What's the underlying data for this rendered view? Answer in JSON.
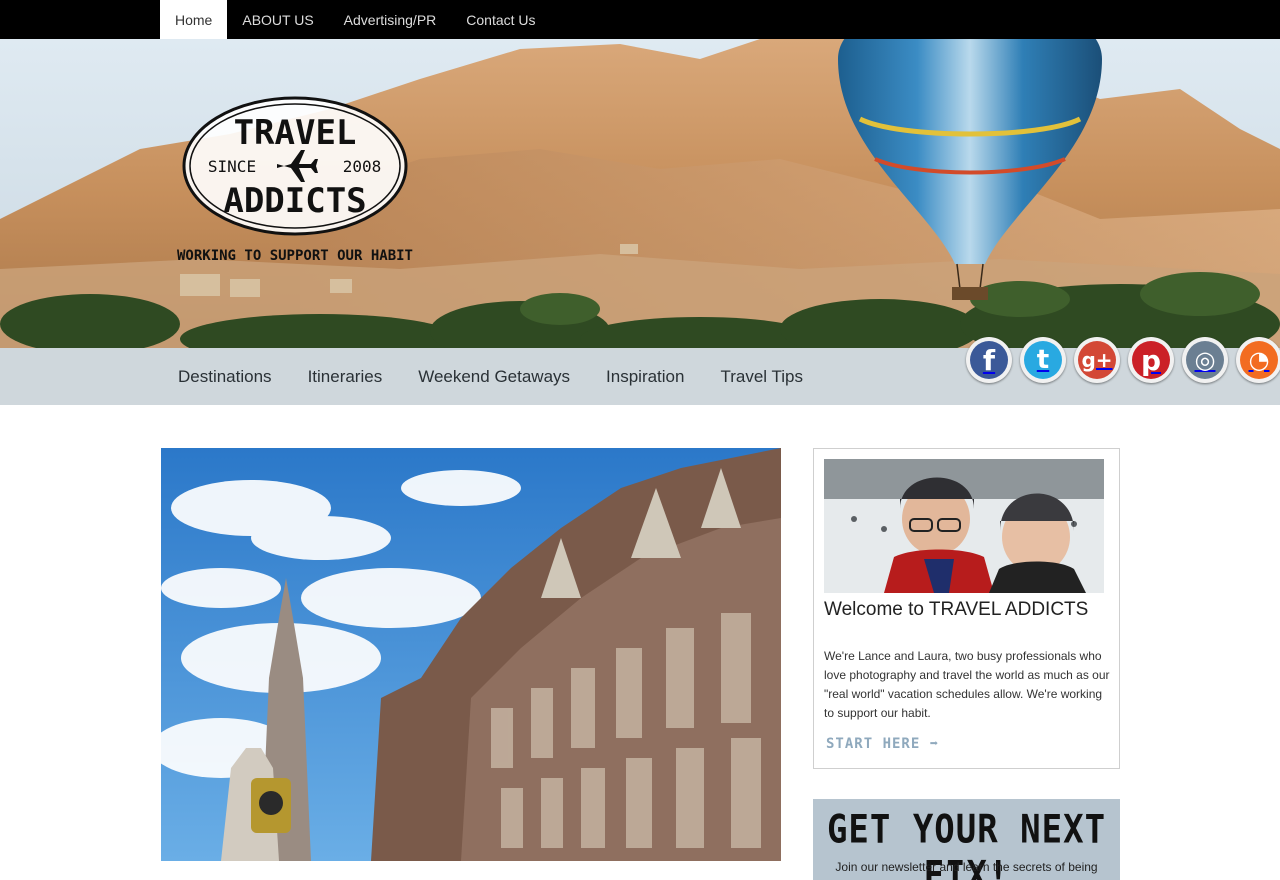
{
  "topnav": {
    "items": [
      {
        "label": "Home",
        "active": true
      },
      {
        "label": "ABOUT US",
        "active": false
      },
      {
        "label": "Advertising/PR",
        "active": false
      },
      {
        "label": "Contact Us",
        "active": false
      }
    ]
  },
  "logo": {
    "line1": "TRAVEL",
    "since": "SINCE",
    "year": "2008",
    "line2": "ADDICTS",
    "tagline": "WORKING TO SUPPORT OUR HABIT"
  },
  "mainnav": {
    "items": [
      "Destinations",
      "Itineraries",
      "Weekend Getaways",
      "Inspiration",
      "Travel Tips"
    ]
  },
  "social": [
    {
      "icon": "facebook-icon",
      "glyph": "f",
      "color": "#3b5998"
    },
    {
      "icon": "twitter-icon",
      "glyph": "t",
      "color": "#29a9e1"
    },
    {
      "icon": "google-plus-icon",
      "glyph": "g+",
      "color": "#d34836"
    },
    {
      "icon": "pinterest-icon",
      "glyph": "p",
      "color": "#cb2027"
    },
    {
      "icon": "instagram-icon",
      "glyph": "◎",
      "color": "#6b7f92"
    },
    {
      "icon": "rss-icon",
      "glyph": "◔",
      "color": "#f26c21"
    }
  ],
  "welcome": {
    "title": "Welcome to TRAVEL ADDICTS",
    "text": "We're Lance and Laura, two busy professionals who love photography and travel the world as much as our \"real world\" vacation schedules allow. We're working to support our habit.",
    "cta": "START HERE ➡"
  },
  "newsletter": {
    "title": "GET YOUR NEXT FIX!",
    "text": "Join our newsletter and learn the secrets of being"
  },
  "colors": {
    "topbar": "#000000",
    "mainnav": "#cfd7dc",
    "newsletter_bg": "#b6c4cf",
    "accent": "#8fa9bd"
  }
}
